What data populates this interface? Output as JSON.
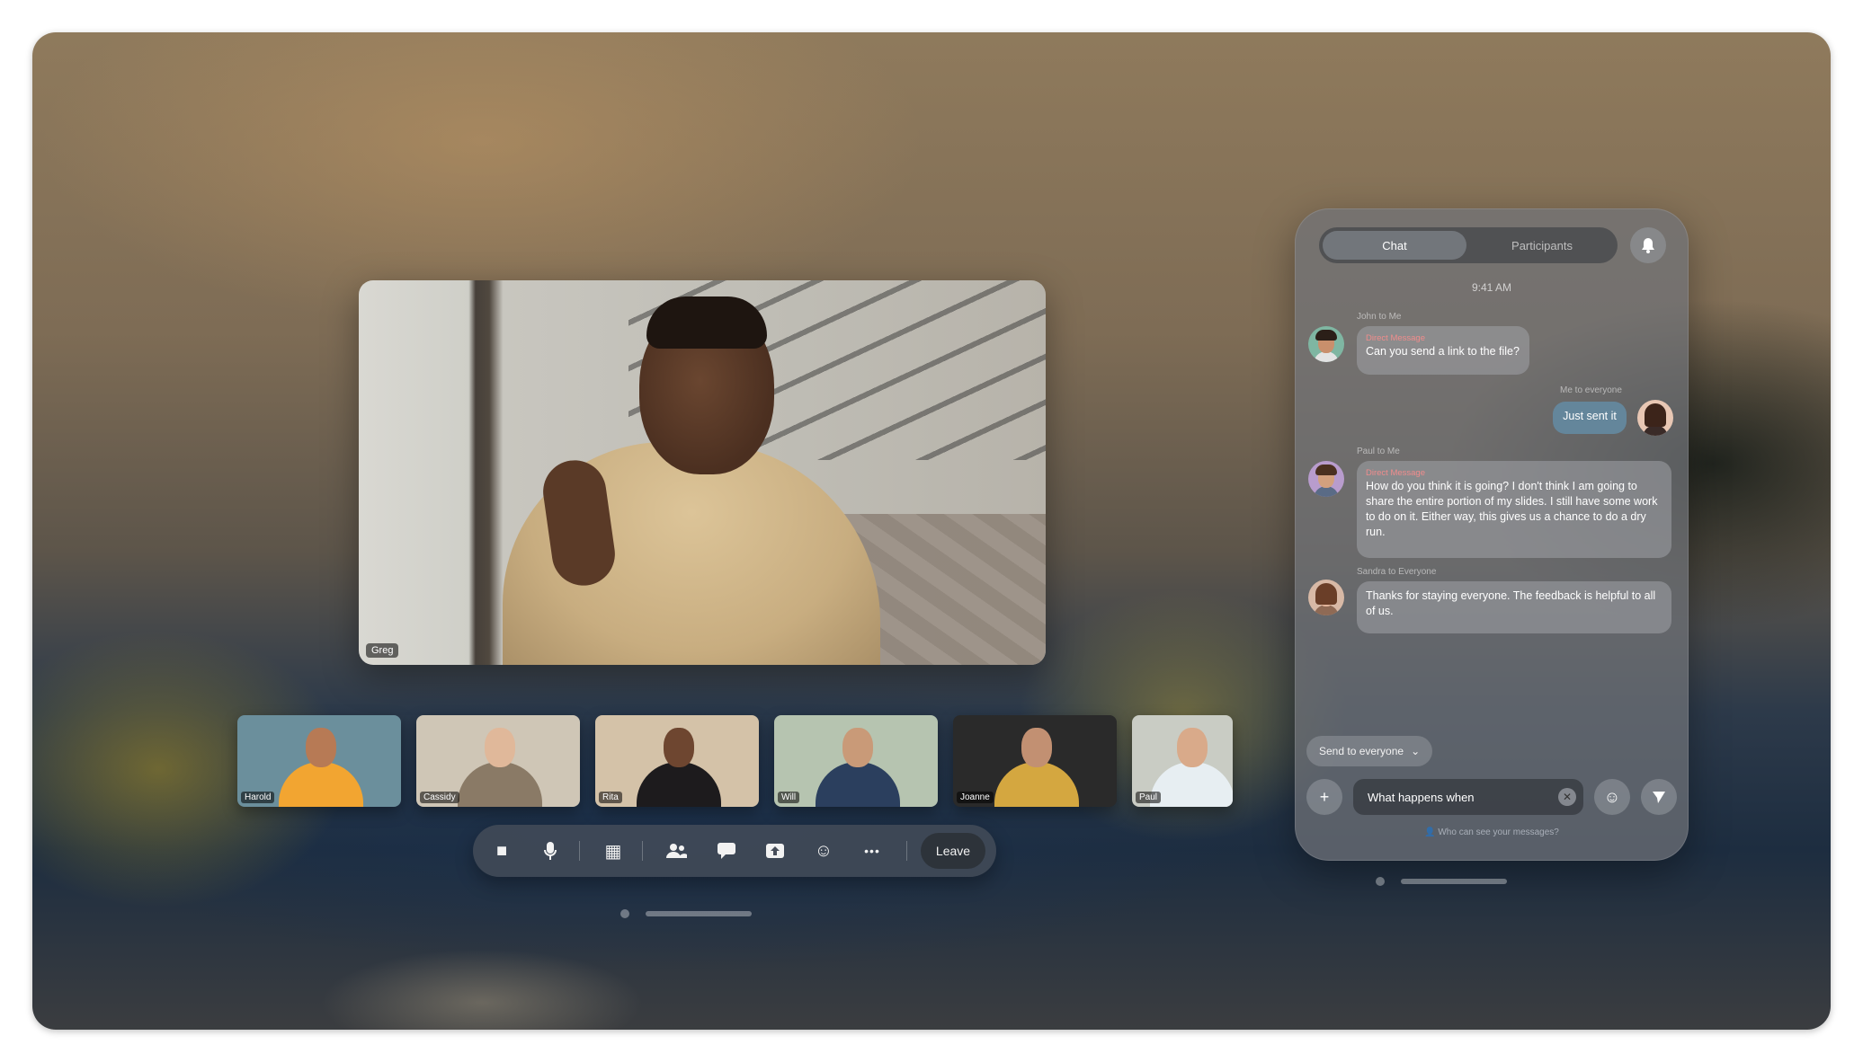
{
  "main_video": {
    "name": "Greg"
  },
  "participants": [
    {
      "name": "Harold",
      "bg": "#6b8f9c",
      "skin": "#b77a55",
      "shirt": "#f2a531"
    },
    {
      "name": "Cassidy",
      "bg": "#cfc6b6",
      "skin": "#e0b89a",
      "shirt": "#8a7a66"
    },
    {
      "name": "Rita",
      "bg": "#d4c2a8",
      "skin": "#6e4630",
      "shirt": "#1d1b1d"
    },
    {
      "name": "Will",
      "bg": "#b6c4b0",
      "skin": "#c99a78",
      "shirt": "#2b3f5e"
    },
    {
      "name": "Joanne",
      "bg": "#2a2a2a",
      "skin": "#c29072",
      "shirt": "#d4a740"
    },
    {
      "name": "Paul",
      "bg": "#c9ccc4",
      "skin": "#d9aa8a",
      "shirt": "#e7eef2"
    }
  ],
  "toolbar": {
    "buttons": [
      {
        "icon": "video-camera-icon",
        "glyph": "■"
      },
      {
        "icon": "microphone-icon",
        "glyph": "🎙"
      },
      {
        "icon": "clapper-icon",
        "glyph": "▦"
      },
      {
        "icon": "people-icon",
        "glyph": "👥"
      },
      {
        "icon": "chat-bubble-icon",
        "glyph": "▬"
      },
      {
        "icon": "share-screen-icon",
        "glyph": "⬆"
      },
      {
        "icon": "emoji-reaction-icon",
        "glyph": "☺"
      },
      {
        "icon": "more-icon",
        "glyph": "•••"
      }
    ],
    "leave_label": "Leave"
  },
  "chat": {
    "tabs": {
      "chat": "Chat",
      "participants": "Participants"
    },
    "time": "9:41 AM",
    "messages": [
      {
        "meta": "John to Me",
        "dm": "Direct Message",
        "text": "Can you send a link to the file?"
      },
      {
        "meta": "Me to everyone",
        "text": "Just sent it"
      },
      {
        "meta": "Paul to Me",
        "dm": "Direct Message",
        "text": "How do you think it is going? I don't think I am going to share the entire portion of my slides. I still have some work to do on it. Either way, this gives us a chance to do a dry run."
      },
      {
        "meta": "Sandra to Everyone",
        "text": "Thanks for staying everyone. The feedback is helpful to all of us."
      }
    ],
    "send_to": "Send to everyone",
    "input_value": "What happens when",
    "privacy": "Who can see your messages?"
  },
  "colors": {
    "dm_label": "#f08c8c",
    "my_bubble": "#648ca5"
  }
}
